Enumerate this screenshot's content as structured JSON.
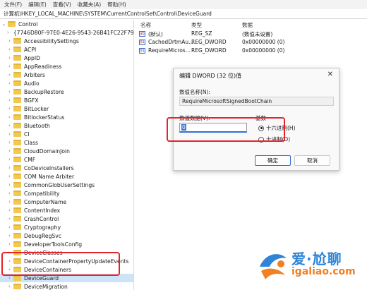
{
  "menu": [
    "文件(F)",
    "编辑(E)",
    "查看(V)",
    "收藏夹(A)",
    "帮助(H)"
  ],
  "address": "计算机\\HKEY_LOCAL_MACHINE\\SYSTEM\\CurrentControlSet\\Control\\DeviceGuard",
  "tree": [
    {
      "label": "Control",
      "level": 0,
      "expanded": true
    },
    {
      "label": "{7746D80F-97E0-4E26-9543-26B41FC22F79}",
      "level": 1
    },
    {
      "label": "AccessibilitySettings",
      "level": 1
    },
    {
      "label": "ACPI",
      "level": 1
    },
    {
      "label": "AppID",
      "level": 1
    },
    {
      "label": "AppReadiness",
      "level": 1
    },
    {
      "label": "Arbiters",
      "level": 1
    },
    {
      "label": "Audio",
      "level": 1
    },
    {
      "label": "BackupRestore",
      "level": 1
    },
    {
      "label": "BGFX",
      "level": 1
    },
    {
      "label": "BitLocker",
      "level": 1
    },
    {
      "label": "BitlockerStatus",
      "level": 1
    },
    {
      "label": "Bluetooth",
      "level": 1
    },
    {
      "label": "CI",
      "level": 1
    },
    {
      "label": "Class",
      "level": 1
    },
    {
      "label": "CloudDomainJoin",
      "level": 1
    },
    {
      "label": "CMF",
      "level": 1
    },
    {
      "label": "CoDeviceInstallers",
      "level": 1
    },
    {
      "label": "COM Name Arbiter",
      "level": 1
    },
    {
      "label": "CommonGlobUserSettings",
      "level": 1
    },
    {
      "label": "Compatibility",
      "level": 1
    },
    {
      "label": "ComputerName",
      "level": 1
    },
    {
      "label": "ContentIndex",
      "level": 1
    },
    {
      "label": "CrashControl",
      "level": 1
    },
    {
      "label": "Cryptography",
      "level": 1
    },
    {
      "label": "DebugRegSvc",
      "level": 1
    },
    {
      "label": "DeveloperToolsConfig",
      "level": 1
    },
    {
      "label": "DeviceClasses",
      "level": 1
    },
    {
      "label": "DeviceContainerPropertyUpdateEvents",
      "level": 1
    },
    {
      "label": "DeviceContainers",
      "level": 1
    },
    {
      "label": "DeviceGuard",
      "level": 1,
      "selected": true
    },
    {
      "label": "DeviceMigration",
      "level": 1
    }
  ],
  "list_headers": {
    "name": "名称",
    "type": "类型",
    "data": "数据"
  },
  "list_rows": [
    {
      "name": "(默认)",
      "type": "REG_SZ",
      "data": "(数值未设置)",
      "icon": "ab"
    },
    {
      "name": "CachedDrtmAu...",
      "type": "REG_DWORD",
      "data": "0x00000000 (0)",
      "icon": "01"
    },
    {
      "name": "RequireMicros...",
      "type": "REG_DWORD",
      "data": "0x00000000 (0)",
      "icon": "01"
    }
  ],
  "dialog": {
    "title": "编辑 DWORD (32 位)值",
    "name_label": "数值名称(N):",
    "name_value": "RequireMicrosoftSignedBootChain",
    "value_label": "数值数据(V):",
    "value_data": "0",
    "base_label": "基数",
    "radio_hex": "十六进制(H)",
    "radio_dec": "十进制(D)",
    "ok": "确定",
    "cancel": "取消"
  },
  "watermark": {
    "cn": "爱·尬聊",
    "en": "igaliao.com"
  }
}
